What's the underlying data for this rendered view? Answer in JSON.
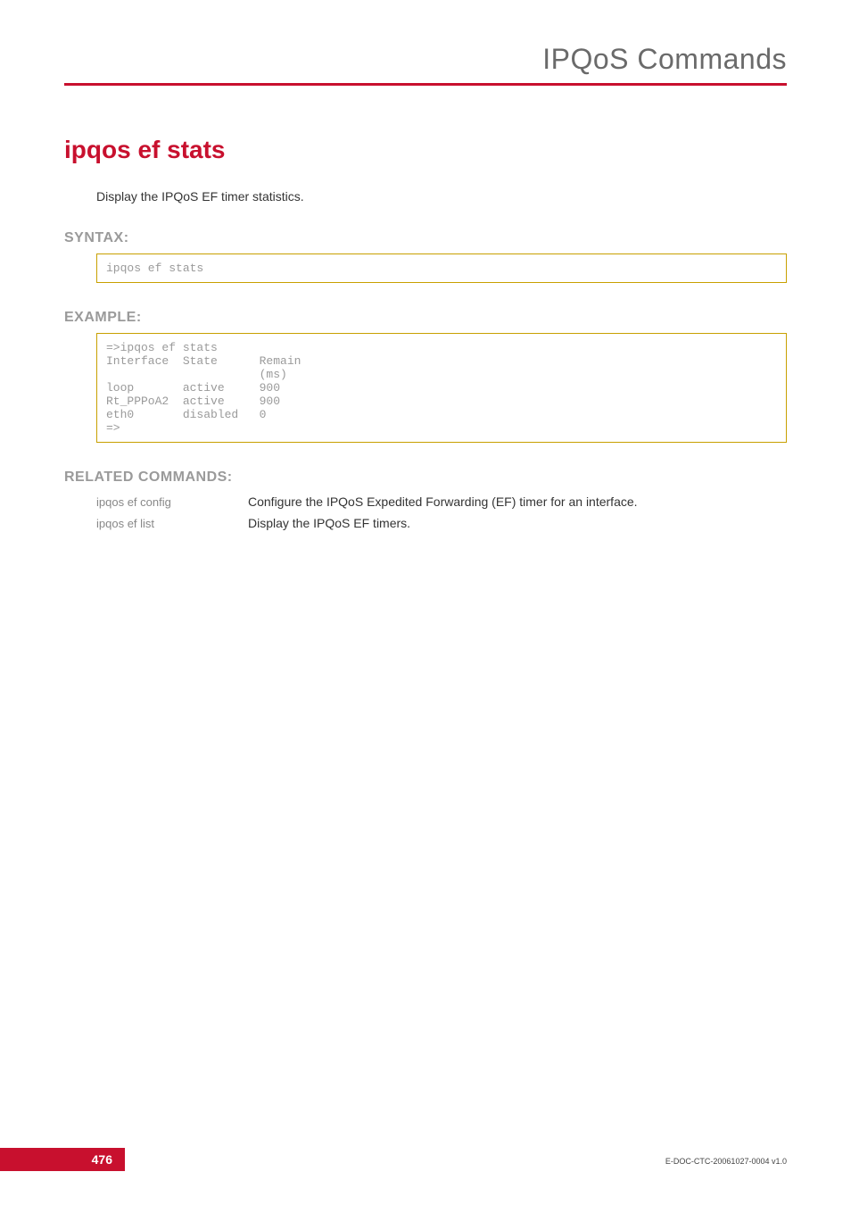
{
  "header": {
    "section_title": "IPQoS Commands"
  },
  "cmd": {
    "title": "ipqos ef stats",
    "description": "Display the IPQoS EF timer statistics."
  },
  "syntax": {
    "label": "SYNTAX:",
    "code": "ipqos ef stats"
  },
  "example": {
    "label": "EXAMPLE:",
    "code": "=>ipqos ef stats\nInterface  State      Remain\n                      (ms)\nloop       active     900\nRt_PPPoA2  active     900\neth0       disabled   0\n=>"
  },
  "related": {
    "label": "RELATED COMMANDS:",
    "items": [
      {
        "link": "ipqos ef config",
        "desc": "Configure the IPQoS Expedited Forwarding (EF) timer for an interface."
      },
      {
        "link": "ipqos ef list",
        "desc": "Display the IPQoS EF timers."
      }
    ]
  },
  "footer": {
    "page": "476",
    "docid": "E-DOC-CTC-20061027-0004 v1.0"
  }
}
